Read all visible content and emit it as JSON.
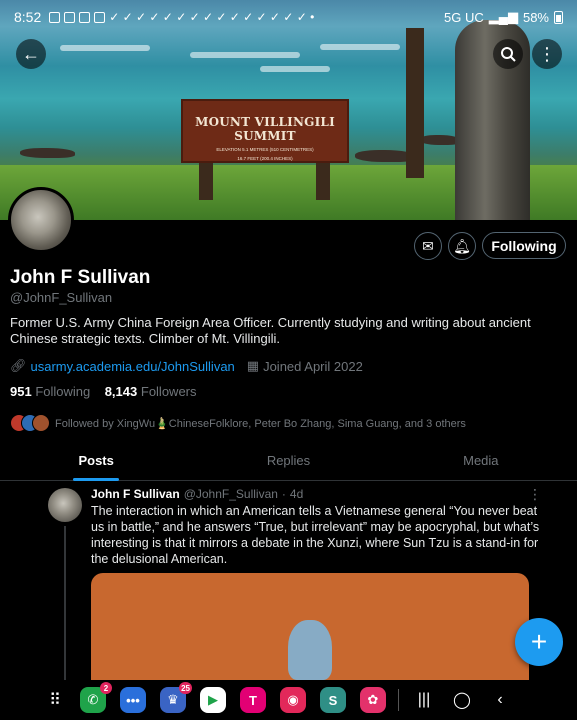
{
  "status_bar": {
    "time": "8:52",
    "network": "5G UC",
    "battery": "58%"
  },
  "banner": {
    "sign_title": "MOUNT VILLINGILI SUMMIT",
    "sign_line1": "ELEVATION 5.1 METRES (510 CENTIMETRES)",
    "sign_line2": "16.7 FEET (200.4 INCHES)"
  },
  "profile": {
    "name": "John F Sullivan",
    "handle": "@JohnF_Sullivan",
    "bio": "Former U.S. Army China Foreign Area Officer. Currently studying and writing about ancient Chinese strategic texts. Climber of Mt. Villingili.",
    "link": "usarmy.academia.edu/JohnSullivan",
    "joined": "Joined April 2022",
    "following_count": "951",
    "following_label": "Following",
    "followers_count": "8,143",
    "followers_label": "Followers",
    "followed_by": "Followed by XingWu🎍ChineseFolklore, Peter Bo Zhang, Sima Guang, and 3 others",
    "follow_button": "Following"
  },
  "tabs": [
    "Posts",
    "Replies",
    "Media"
  ],
  "post": {
    "author": "John F Sullivan",
    "handle": "@JohnF_Sullivan",
    "dot": "·",
    "time": "4d",
    "text": "The interaction in which an American tells a Vietnamese general “You never beat us in battle,” and he answers “True, but irrelevant” may be apocryphal, but what’s interesting is that it mirrors a debate in the Xunzi, where Sun Tzu is a stand-in for the delusional American."
  },
  "nav_apps": [
    {
      "name": "phone",
      "color": "#1fa34a",
      "glyph": "✆",
      "badge": "2"
    },
    {
      "name": "messages",
      "color": "#2a6fdb",
      "glyph": "•••",
      "badge": ""
    },
    {
      "name": "brave",
      "color": "#3a64c4",
      "glyph": "♛",
      "badge": "25"
    },
    {
      "name": "play-store",
      "color": "#ffffff",
      "glyph": "▶",
      "badge": ""
    },
    {
      "name": "t-mobile",
      "color": "#e20074",
      "glyph": "T",
      "badge": ""
    },
    {
      "name": "camera",
      "color": "#e2285a",
      "glyph": "◉",
      "badge": ""
    },
    {
      "name": "samsung-app",
      "color": "#2f8f86",
      "glyph": "S",
      "badge": ""
    },
    {
      "name": "blossom",
      "color": "#e3316b",
      "glyph": "✿",
      "badge": ""
    }
  ]
}
